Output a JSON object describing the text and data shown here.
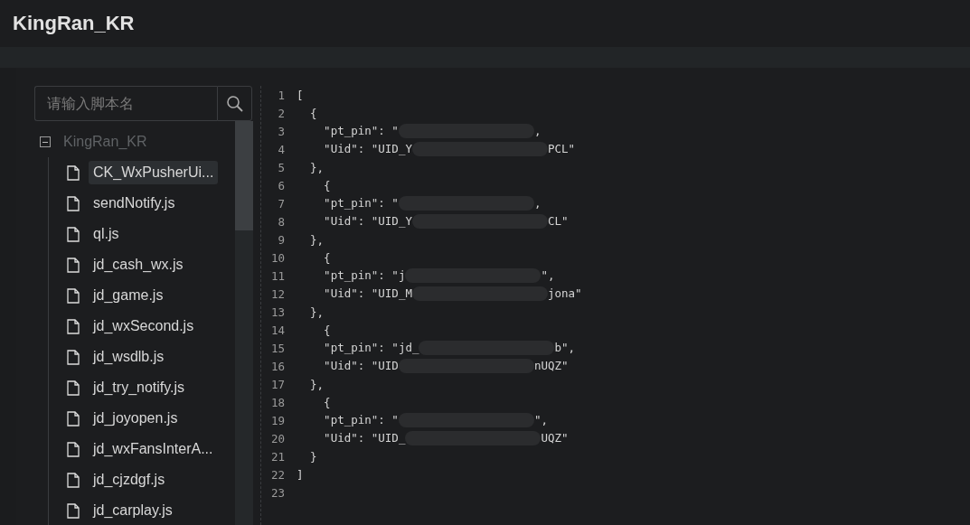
{
  "header": {
    "title": "KingRan_KR"
  },
  "sidebar": {
    "search": {
      "placeholder": "请输入脚本名"
    },
    "tree": [
      {
        "label": "KingRan_KR",
        "expanded": true,
        "children": [
          {
            "label": "CK_WxPusherUi...",
            "selected": true
          },
          {
            "label": "sendNotify.js",
            "selected": false
          },
          {
            "label": "ql.js",
            "selected": false
          },
          {
            "label": "jd_cash_wx.js",
            "selected": false
          },
          {
            "label": "jd_game.js",
            "selected": false
          },
          {
            "label": "jd_wxSecond.js",
            "selected": false
          },
          {
            "label": "jd_wsdlb.js",
            "selected": false
          },
          {
            "label": "jd_try_notify.js",
            "selected": false
          },
          {
            "label": "jd_joyopen.js",
            "selected": false
          },
          {
            "label": "jd_wxFansInterA...",
            "selected": false
          },
          {
            "label": "jd_cjzdgf.js",
            "selected": false
          },
          {
            "label": "jd_carplay.js",
            "selected": false
          }
        ]
      }
    ]
  },
  "editor": {
    "lines": [
      {
        "number": "1",
        "text": "["
      },
      {
        "number": "2",
        "text": "  {"
      },
      {
        "number": "3",
        "text": "    \"pt_pin\": \"",
        "redacted": true,
        "after": ","
      },
      {
        "number": "4",
        "text": "    \"Uid\": \"UID_Y",
        "redacted": true,
        "after": "PCL\""
      },
      {
        "number": "5",
        "text": "  },"
      },
      {
        "number": "6",
        "text": "    {"
      },
      {
        "number": "7",
        "text": "    \"pt_pin\": \"",
        "redacted": true,
        "after": ","
      },
      {
        "number": "8",
        "text": "    \"Uid\": \"UID_Y",
        "redacted": true,
        "after": "CL\""
      },
      {
        "number": "9",
        "text": "  },"
      },
      {
        "number": "10",
        "text": "    {"
      },
      {
        "number": "11",
        "text": "    \"pt_pin\": \"j",
        "redacted": true,
        "after": "\","
      },
      {
        "number": "12",
        "text": "    \"Uid\": \"UID_M",
        "redacted": true,
        "after": "jona\""
      },
      {
        "number": "13",
        "text": "  },"
      },
      {
        "number": "14",
        "text": "    {"
      },
      {
        "number": "15",
        "text": "    \"pt_pin\": \"jd_",
        "redacted": true,
        "after": "b\","
      },
      {
        "number": "16",
        "text": "    \"Uid\": \"UID",
        "redacted": true,
        "after": "nUQZ\""
      },
      {
        "number": "17",
        "text": "  },"
      },
      {
        "number": "18",
        "text": "    {"
      },
      {
        "number": "19",
        "text": "    \"pt_pin\": \"",
        "redacted": true,
        "after": "\","
      },
      {
        "number": "20",
        "text": "    \"Uid\": \"UID_",
        "redacted": true,
        "after": "UQZ\""
      },
      {
        "number": "21",
        "text": "  }"
      },
      {
        "number": "22",
        "text": "]"
      },
      {
        "number": "23"
      }
    ]
  }
}
